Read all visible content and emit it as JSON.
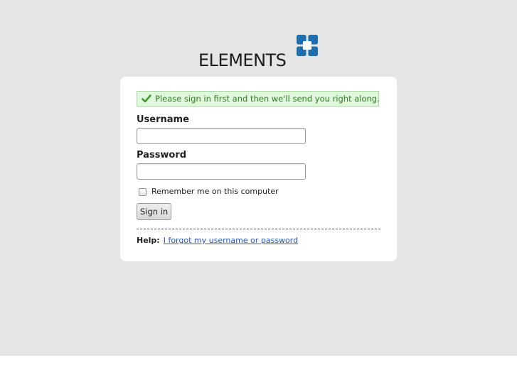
{
  "brand": {
    "logo_text": "ELEMENTS",
    "logo_color": "#1e6fb0"
  },
  "flash": {
    "message": "Please sign in first and then we'll send you right along.",
    "icon": "checkmark-icon",
    "text_color": "#2f7d1f",
    "background_color": "#e2f8de"
  },
  "form": {
    "username_label": "Username",
    "username_value": "",
    "password_label": "Password",
    "password_value": "",
    "remember_label": "Remember me on this computer",
    "remember_checked": false,
    "submit_label": "Sign in"
  },
  "help": {
    "label": "Help:",
    "forgot_link": "I forgot my username or password",
    "link_color": "#2a4fc0"
  }
}
